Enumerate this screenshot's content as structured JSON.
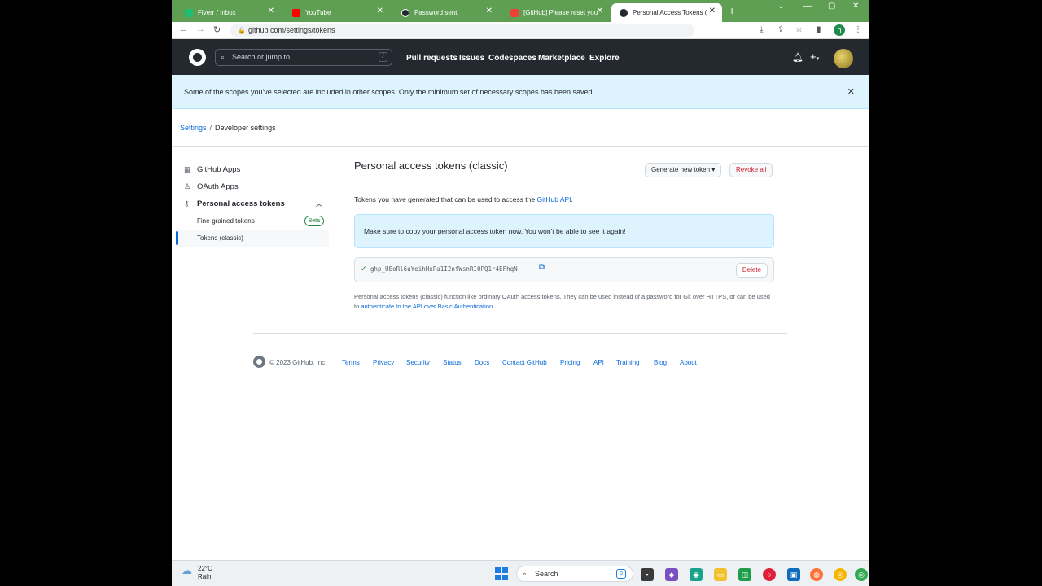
{
  "browser": {
    "tabs": [
      {
        "title": "Fiverr / Inbox",
        "color": "#1dbf73"
      },
      {
        "title": "YouTube",
        "color": "#ff0000"
      },
      {
        "title": "Password sent!",
        "color": "#24292f"
      },
      {
        "title": "[GitHub] Please reset you",
        "color": "#ea4335"
      },
      {
        "title": "Personal Access Tokens (",
        "color": "#24292f"
      }
    ],
    "url": "github.com/settings/tokens",
    "profile_initial": "h"
  },
  "github_header": {
    "search_placeholder": "Search or jump to...",
    "search_shortcut": "/",
    "nav": [
      "Pull requests",
      "Issues",
      "Codespaces",
      "Marketplace",
      "Explore"
    ],
    "plus": "+"
  },
  "flash": {
    "message": "Some of the scopes you've selected are included in other scopes. Only the minimum set of necessary scopes has been saved."
  },
  "breadcrumb": {
    "root": "Settings",
    "separator": "/",
    "current": "Developer settings"
  },
  "sidebar": {
    "items": [
      {
        "label": "GitHub Apps",
        "icon": "grid-icon"
      },
      {
        "label": "OAuth Apps",
        "icon": "person-icon"
      },
      {
        "label": "Personal access tokens",
        "icon": "key-icon"
      }
    ],
    "sub_items": [
      {
        "label": "Fine-grained tokens",
        "badge": "Beta"
      },
      {
        "label": "Tokens (classic)"
      }
    ]
  },
  "main": {
    "title": "Personal access tokens (classic)",
    "generate_button": "Generate new token",
    "revoke_button": "Revoke all",
    "intro_text": "Tokens you have generated that can be used to access the ",
    "intro_link": "GitHub API",
    "intro_end": ".",
    "notice": "Make sure to copy your personal access token now. You won't be able to see it again!",
    "token": "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",
    "delete_button": "Delete",
    "footnote_text": "Personal access tokens (classic) function like ordinary OAuth access tokens. They can be used instead of a password for Git over HTTPS, or can be used to ",
    "footnote_link": "authenticate to the API over Basic Authentication",
    "footnote_end": "."
  },
  "footer": {
    "copyright": "© 2023 GitHub, Inc.",
    "links": [
      "Terms",
      "Privacy",
      "Security",
      "Status",
      "Docs",
      "Contact GitHub",
      "Pricing",
      "API",
      "Training",
      "Blog",
      "About"
    ]
  },
  "taskbar": {
    "temperature": "22°C",
    "condition": "Rain",
    "search": "Search"
  }
}
